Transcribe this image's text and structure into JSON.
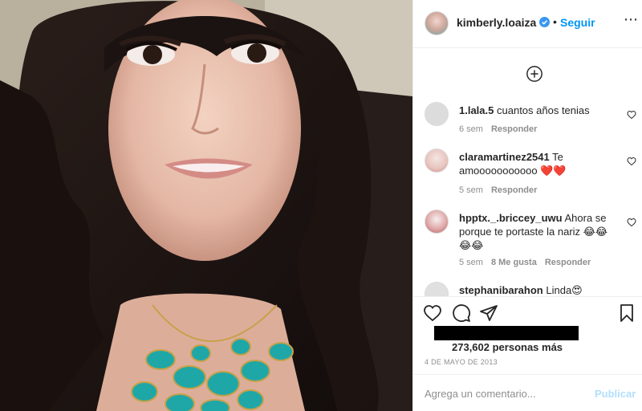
{
  "post": {
    "username": "kimberly.loaiza",
    "follow_label": "Seguir",
    "more_icon": "more-options-icon",
    "verified_color": "#3897f0"
  },
  "comments": [
    {
      "user": "1.lala.5",
      "text": "cuantos años tenias",
      "time": "6 sem",
      "likes": "",
      "reply": "Responder",
      "avatar_color": "#dcdcdc"
    },
    {
      "user": "claramartinez2541",
      "text": "Te amooooooooooo ❤️❤️",
      "time": "5 sem",
      "likes": "",
      "reply": "Responder",
      "avatar_color": "#e9c9c4"
    },
    {
      "user": "hpptx._.briccey_uwu",
      "text": "Ahora se porque te portaste la nariz 😂😂😂😂",
      "time": "5 sem",
      "likes": "8 Me gusta",
      "reply": "Responder",
      "avatar_color": "#d8a6a6"
    },
    {
      "user": "stephanibarahon",
      "text": "Linda😍",
      "time": "",
      "likes": "",
      "reply": "",
      "avatar_color": "#e0e0e0"
    }
  ],
  "likes": {
    "count_text": "273,602 personas más"
  },
  "date": "4 DE MAYO DE 2013",
  "comment_box": {
    "placeholder": "Agrega un comentario...",
    "publish_label": "Publicar"
  },
  "colors": {
    "accent": "#0095f6",
    "publish_disabled": "#b2dffc",
    "secondary_text": "#8e8e8e"
  }
}
